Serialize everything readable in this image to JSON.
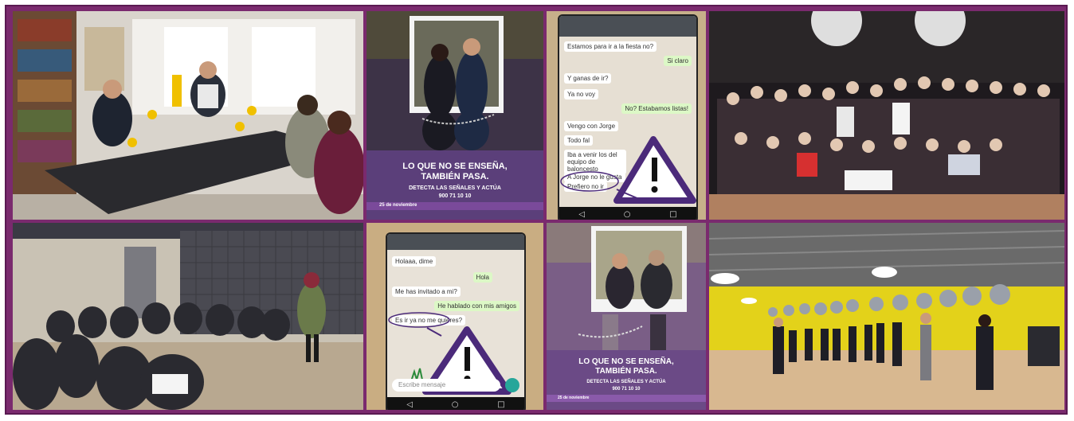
{
  "poster_1": {
    "title_line1": "LO QUE NO SE ENSEÑA,",
    "title_line2": "TAMBIÉN PASA.",
    "subtitle": "DETECTA LAS SEÑALES Y ACTÚA",
    "phone": "900 71 10 10",
    "date": "25 de noviembre"
  },
  "phone_1": {
    "messages": [
      "Estamos para ir a la fiesta no?",
      "Si claro",
      "Y ganas de ir?",
      "Ya no voy",
      "No? Estabamos listas!",
      "Vengo con Jorge",
      "Todo fal",
      "Iba a venir los del equipo de baloncesto",
      "A Jorge no le gusta",
      "Prefiero no ir"
    ]
  },
  "phone_2": {
    "messages": [
      "Holaaa, dime",
      "Hola",
      "Me has invitado a mi?",
      "He hablado con mis amigos",
      "Es ir ya no me quieres?"
    ],
    "input_placeholder": "Escribe mensaje"
  },
  "poster_2": {
    "title_line1": "LO QUE NO SE ENSEÑA,",
    "title_line2": "TAMBIÉN PASA.",
    "subtitle": "DETECTA LAS SEÑALES Y ACTÚA",
    "phone": "900 71 10 10",
    "date": "25 de noviembre"
  },
  "colors": {
    "frame": "#7a2a6e",
    "poster_purple": "#5b3f7a",
    "warning_purple": "#4b2a7a",
    "gym_yellow": "#e3d21a"
  }
}
